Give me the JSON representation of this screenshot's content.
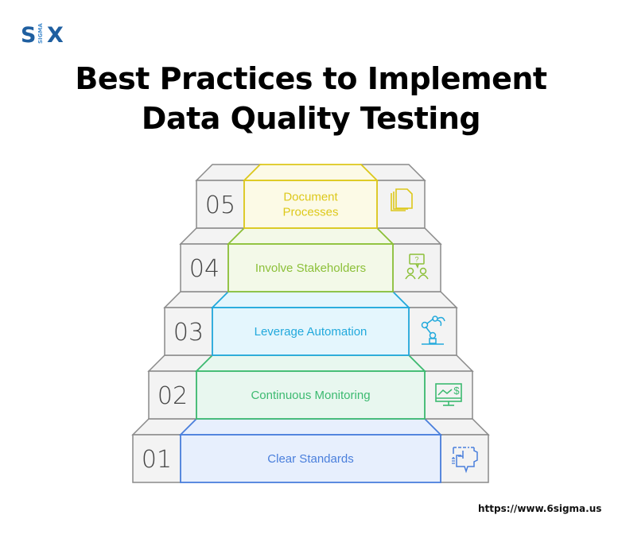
{
  "brand": {
    "logo_left": "S",
    "logo_mid": "SIGMA",
    "logo_right": "X",
    "color": "#1f5fa0"
  },
  "title": {
    "line1": "Best Practices to Implement",
    "line2": "Data Quality Testing"
  },
  "steps": [
    {
      "number": "01",
      "label": [
        "Clear Standards"
      ],
      "icon": "blueprint-icon",
      "color": "#4a7fdc",
      "fill": "#e7effd"
    },
    {
      "number": "02",
      "label": [
        "Continuous Monitoring"
      ],
      "icon": "monitor-chart-dollar-icon",
      "color": "#3cba70",
      "fill": "#e8f7ef"
    },
    {
      "number": "03",
      "label": [
        "Leverage Automation"
      ],
      "icon": "robot-arm-icon",
      "color": "#22a9dc",
      "fill": "#e4f6fd"
    },
    {
      "number": "04",
      "label": [
        "Involve Stakeholders"
      ],
      "icon": "people-question-icon",
      "color": "#8cc039",
      "fill": "#f3f9e8"
    },
    {
      "number": "05",
      "label": [
        "Document",
        "Processes"
      ],
      "icon": "documents-icon",
      "color": "#ddc81a",
      "fill": "#fcfae6"
    }
  ],
  "footer": {
    "url": "https://www.6sigma.us"
  }
}
